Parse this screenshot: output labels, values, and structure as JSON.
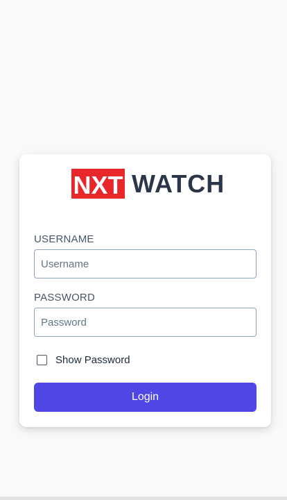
{
  "logo": {
    "box_text": "NXT",
    "word_text": "WATCH",
    "brand_red": "#e9272b",
    "brand_dark": "#2c3649"
  },
  "form": {
    "username_label": "USERNAME",
    "username_placeholder": "Username",
    "username_value": "",
    "password_label": "PASSWORD",
    "password_placeholder": "Password",
    "password_value": "",
    "show_password_label": "Show Password",
    "show_password_checked": false,
    "login_label": "Login",
    "accent_color": "#4f46e5"
  }
}
